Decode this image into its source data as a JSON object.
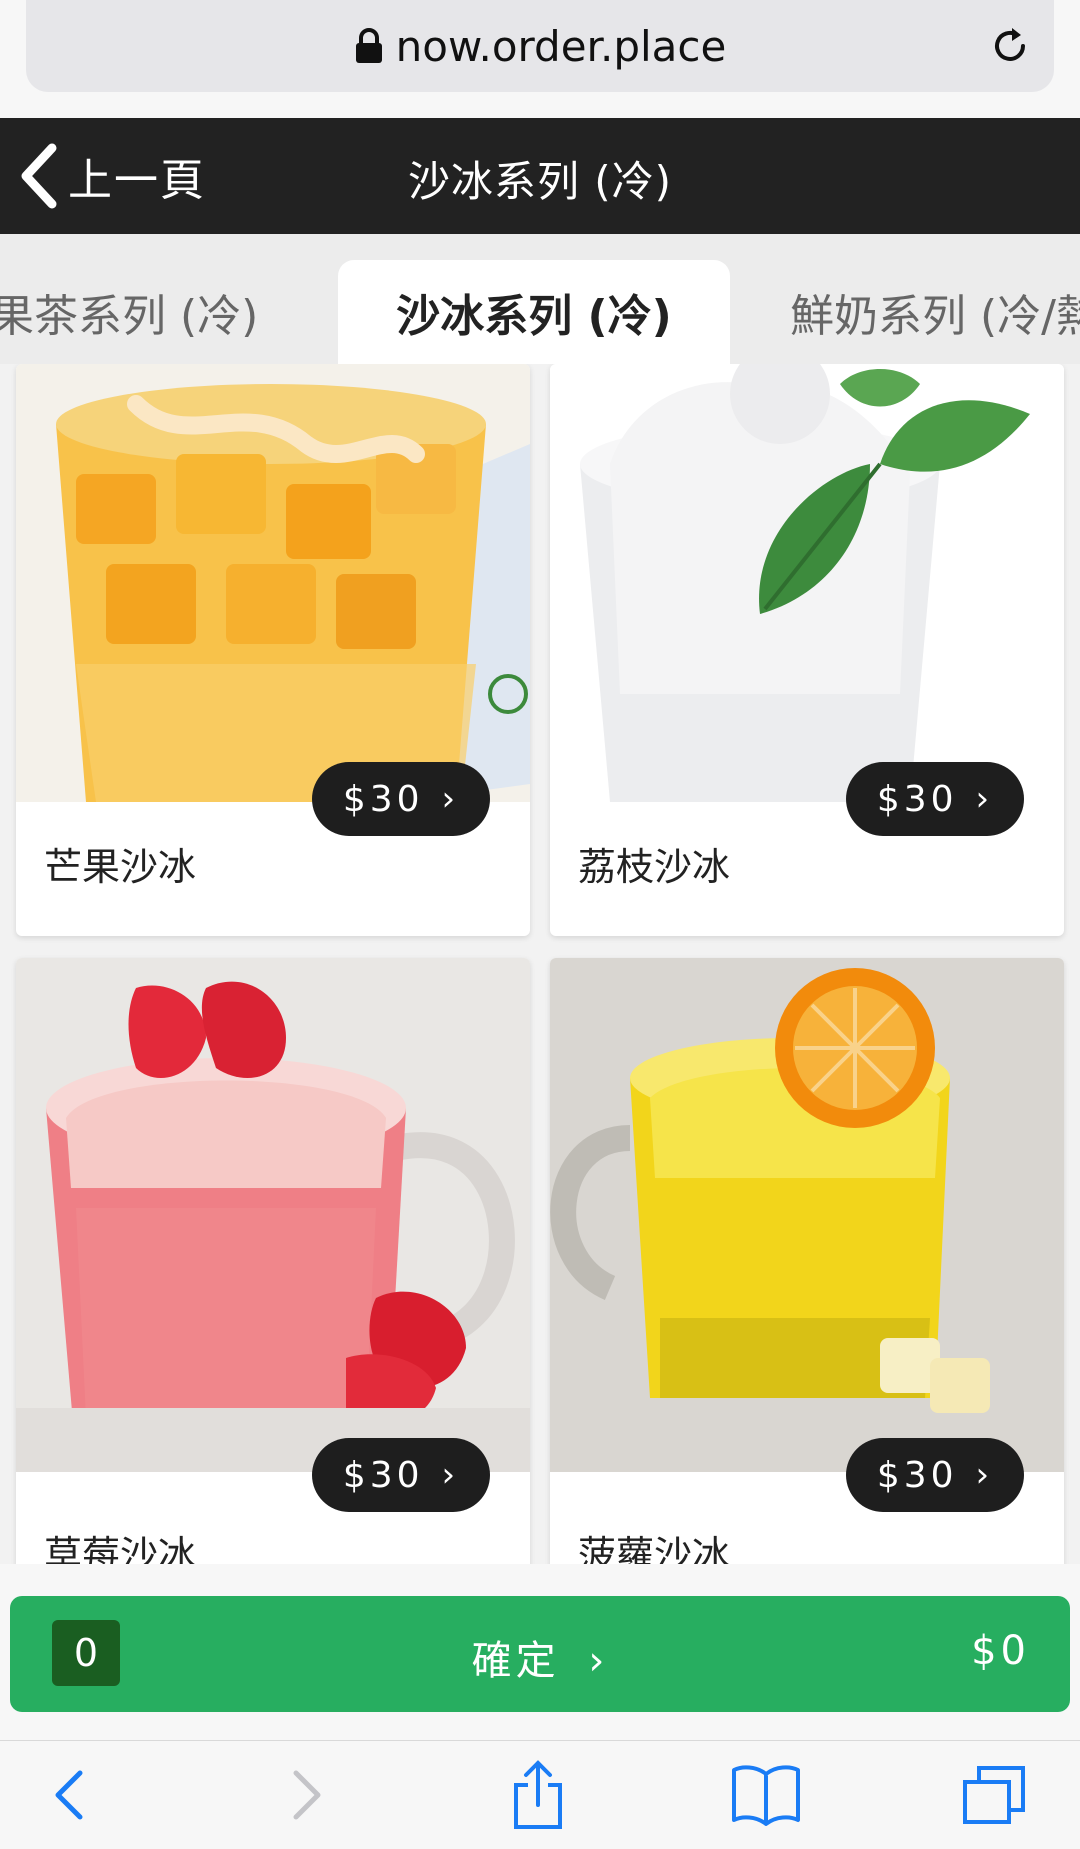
{
  "browser": {
    "url": "now.order.place"
  },
  "header": {
    "back_label": "上一頁",
    "title": "沙冰系列 (冷)"
  },
  "tabs": [
    {
      "label": "果茶系列 (冷)",
      "active": false
    },
    {
      "label": "沙冰系列 (冷)",
      "active": true
    },
    {
      "label": "鮮奶系列 (冷/熱",
      "active": false
    }
  ],
  "products": [
    {
      "name": "芒果沙冰",
      "price": "$30",
      "image": "mango-slush"
    },
    {
      "name": "荔枝沙冰",
      "price": "$30",
      "image": "lychee-slush"
    },
    {
      "name": "草莓沙冰",
      "price": "$30",
      "image": "strawberry-slush"
    },
    {
      "name": "菠蘿沙冰",
      "price": "$30",
      "image": "pineapple-slush"
    }
  ],
  "cart": {
    "count": "0",
    "confirm_label": "確定",
    "total": "$0"
  },
  "colors": {
    "header_bg": "#222222",
    "confirm_green": "#27ae60",
    "count_badge": "#1a5e21",
    "ios_blue": "#1a7cf5"
  }
}
